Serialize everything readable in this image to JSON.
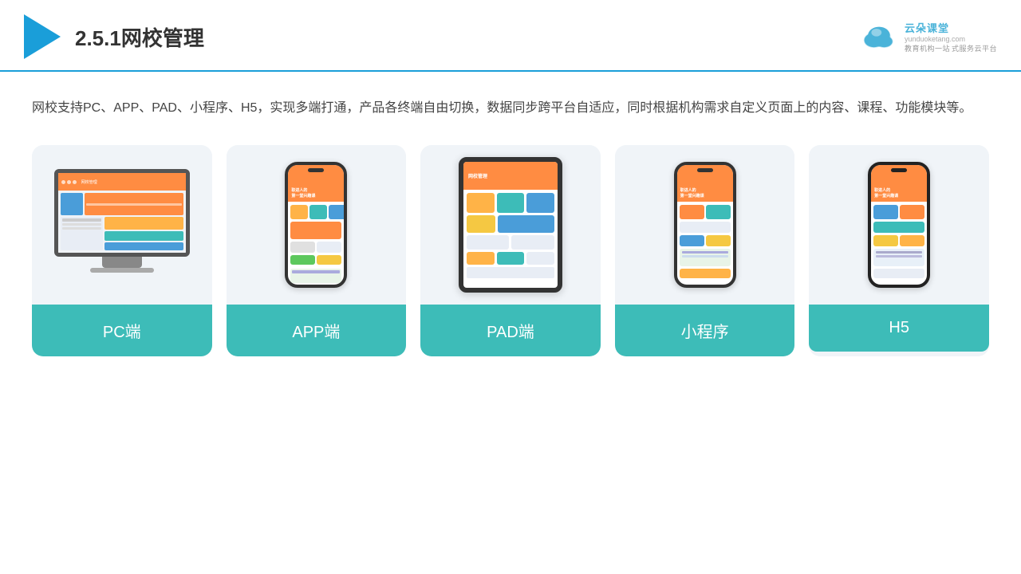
{
  "header": {
    "title": "2.5.1网校管理",
    "brand_name": "云朵课堂",
    "brand_url": "yunduoketang.com",
    "brand_tagline_line1": "教育机构一站",
    "brand_tagline_line2": "式服务云平台"
  },
  "description": "网校支持PC、APP、PAD、小程序、H5，实现多端打通，产品各终端自由切换，数据同步跨平台自适应，同时根据机构需求自定义页面上的内容、课程、功能模块等。",
  "cards": [
    {
      "label": "PC端"
    },
    {
      "label": "APP端"
    },
    {
      "label": "PAD端"
    },
    {
      "label": "小程序"
    },
    {
      "label": "H5"
    }
  ]
}
